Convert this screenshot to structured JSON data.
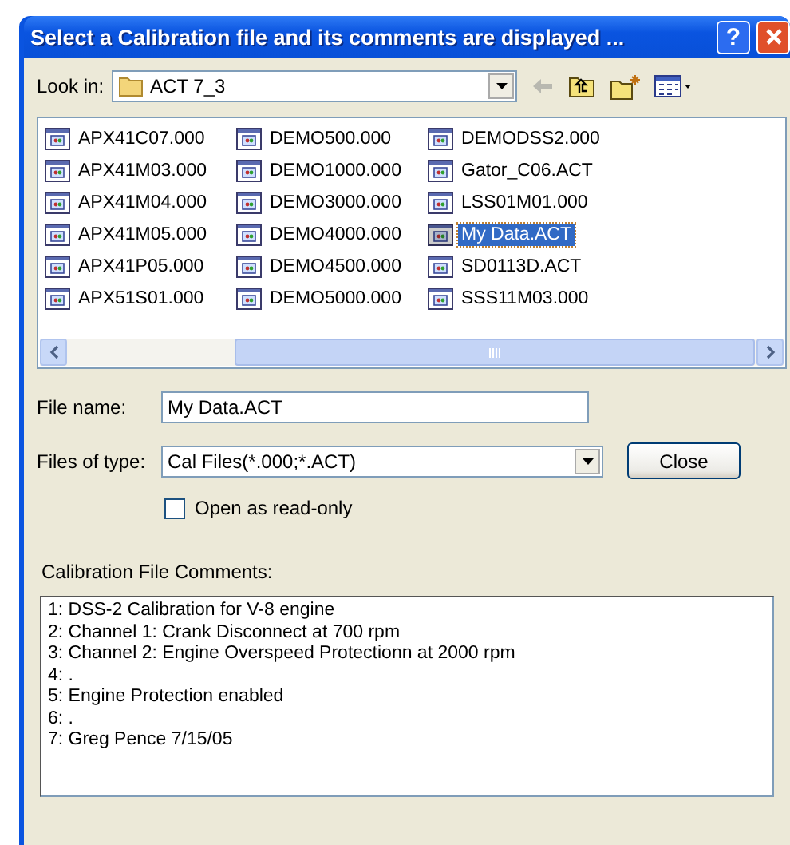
{
  "window": {
    "title": "Select a Calibration file and its comments are displayed ...",
    "help_label": "?"
  },
  "look_in": {
    "label": "Look in:",
    "value": "ACT 7_3"
  },
  "files": [
    {
      "name": "APX41C07.000",
      "selected": false
    },
    {
      "name": "APX41M03.000",
      "selected": false
    },
    {
      "name": "APX41M04.000",
      "selected": false
    },
    {
      "name": "APX41M05.000",
      "selected": false
    },
    {
      "name": "APX41P05.000",
      "selected": false
    },
    {
      "name": "APX51S01.000",
      "selected": false
    },
    {
      "name": "DEMO500.000",
      "selected": false
    },
    {
      "name": "DEMO1000.000",
      "selected": false
    },
    {
      "name": "DEMO3000.000",
      "selected": false
    },
    {
      "name": "DEMO4000.000",
      "selected": false
    },
    {
      "name": "DEMO4500.000",
      "selected": false
    },
    {
      "name": "DEMO5000.000",
      "selected": false
    },
    {
      "name": "DEMODSS2.000",
      "selected": false
    },
    {
      "name": "Gator_C06.ACT",
      "selected": false
    },
    {
      "name": "LSS01M01.000",
      "selected": false
    },
    {
      "name": "My Data.ACT",
      "selected": true
    },
    {
      "name": "SD0113D.ACT",
      "selected": false
    },
    {
      "name": "SSS11M03.000",
      "selected": false
    }
  ],
  "file_name": {
    "label": "File name:",
    "value": "My Data.ACT"
  },
  "files_of_type": {
    "label": "Files of type:",
    "value": "Cal Files(*.000;*.ACT)"
  },
  "close_button": "Close",
  "read_only": {
    "label": "Open as read-only",
    "checked": false
  },
  "comments": {
    "label": "Calibration File Comments:",
    "lines": [
      "1: DSS-2 Calibration for V-8 engine",
      "2: Channel 1: Crank Disconnect at 700 rpm",
      "3: Channel 2: Engine Overspeed Protectionn at 2000 rpm",
      "4: .",
      "5: Engine Protection enabled",
      "6: .",
      "7: Greg Pence 7/15/05"
    ]
  }
}
